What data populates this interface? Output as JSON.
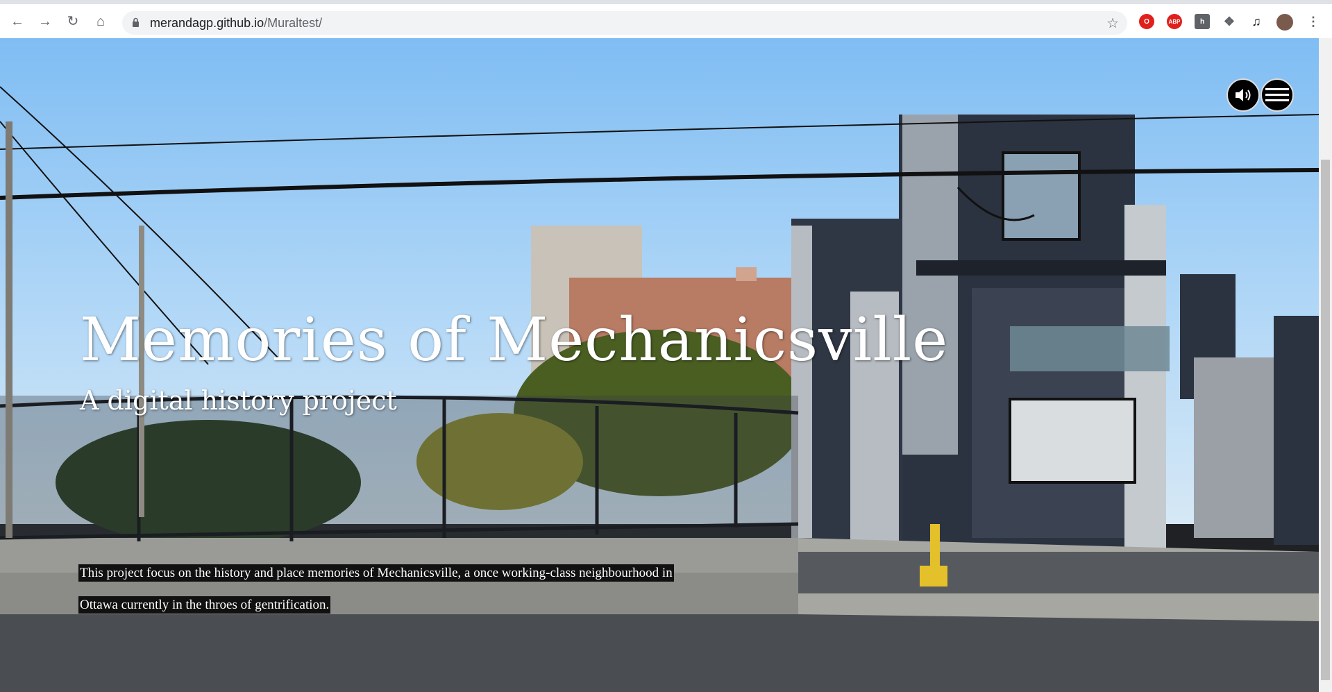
{
  "browser": {
    "url_host": "merandagp.github.io",
    "url_path": "/Muraltest/"
  },
  "hero": {
    "title": "Memories of Mechanicsville",
    "subtitle": "A digital history project",
    "description": "This project focus on the history and place memories of Mechanicsville, a once working-class neighbourhood in Ottawa currently in the throes of gentrification."
  },
  "icons": {
    "back": "back-arrow-icon",
    "forward": "forward-arrow-icon",
    "reload": "reload-icon",
    "home": "home-icon",
    "lock": "lock-icon",
    "bookmark": "star-icon",
    "sound": "speaker-icon",
    "menu": "hamburger-menu-icon"
  },
  "extensions": {
    "abp_label": "ABP"
  },
  "colors": {
    "sky": "#8fc6f5",
    "building_dark": "#2b3240",
    "building_light": "#9aa3ac"
  }
}
